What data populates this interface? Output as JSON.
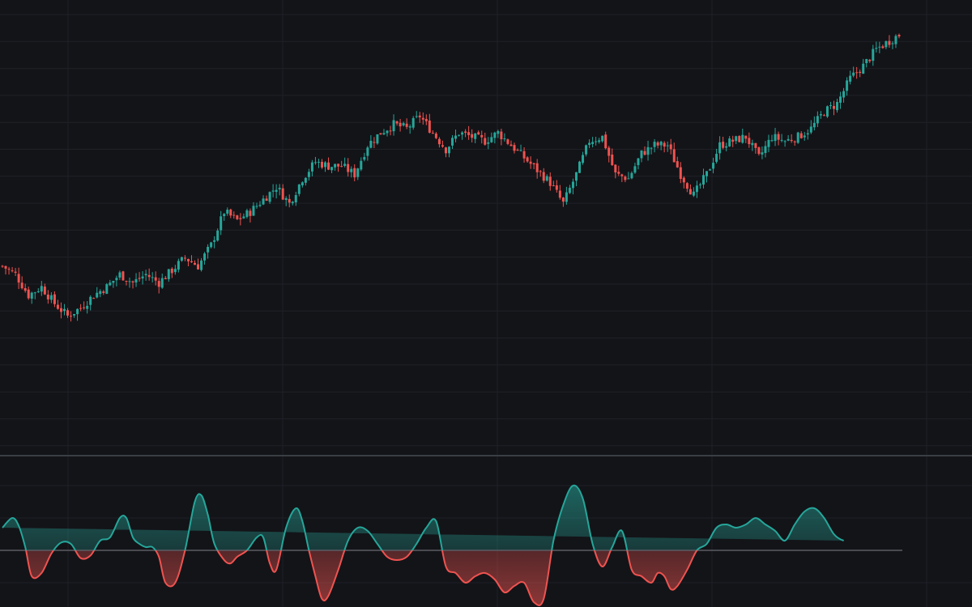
{
  "theme": {
    "background": "#131418",
    "grid": "#1f2127",
    "separator": "#3a3d44",
    "zero_line": "#5a5d63",
    "up_color": "#26a69a",
    "down_color": "#ef5350"
  },
  "chart_data": [
    {
      "type": "candlestick",
      "title": "",
      "xlabel": "",
      "ylabel": "",
      "grid": true,
      "ylim": [
        0,
        100
      ],
      "close_path": [
        [
          0,
          42
        ],
        [
          4,
          40
        ],
        [
          8,
          35
        ],
        [
          12,
          37
        ],
        [
          16,
          33
        ],
        [
          20,
          30
        ],
        [
          24,
          32
        ],
        [
          28,
          35
        ],
        [
          32,
          37
        ],
        [
          36,
          40
        ],
        [
          40,
          38
        ],
        [
          44,
          40
        ],
        [
          48,
          38
        ],
        [
          52,
          41
        ],
        [
          56,
          44
        ],
        [
          60,
          42
        ],
        [
          64,
          47
        ],
        [
          68,
          55
        ],
        [
          72,
          53
        ],
        [
          76,
          55
        ],
        [
          80,
          58
        ],
        [
          84,
          61
        ],
        [
          88,
          57
        ],
        [
          92,
          63
        ],
        [
          96,
          67
        ],
        [
          100,
          66
        ],
        [
          104,
          66
        ],
        [
          108,
          64
        ],
        [
          112,
          71
        ],
        [
          116,
          74
        ],
        [
          120,
          76
        ],
        [
          124,
          75
        ],
        [
          128,
          78
        ],
        [
          132,
          74
        ],
        [
          136,
          70
        ],
        [
          140,
          74
        ],
        [
          144,
          73
        ],
        [
          148,
          72
        ],
        [
          152,
          74
        ],
        [
          156,
          71
        ],
        [
          160,
          68
        ],
        [
          164,
          65
        ],
        [
          168,
          62
        ],
        [
          172,
          57
        ],
        [
          176,
          64
        ],
        [
          180,
          72
        ],
        [
          184,
          73
        ],
        [
          188,
          64
        ],
        [
          192,
          63
        ],
        [
          196,
          69
        ],
        [
          200,
          71
        ],
        [
          204,
          71
        ],
        [
          208,
          64
        ],
        [
          212,
          59
        ],
        [
          216,
          64
        ],
        [
          220,
          71
        ],
        [
          224,
          72
        ],
        [
          228,
          73
        ],
        [
          232,
          68
        ],
        [
          236,
          73
        ],
        [
          240,
          72
        ],
        [
          244,
          73
        ],
        [
          248,
          75
        ],
        [
          252,
          79
        ],
        [
          256,
          81
        ],
        [
          260,
          87
        ],
        [
          264,
          90
        ],
        [
          268,
          94
        ],
        [
          272,
          96
        ],
        [
          276,
          98
        ]
      ],
      "count": 276
    },
    {
      "type": "area",
      "title": "",
      "xlabel": "",
      "ylabel": "",
      "baseline": 0,
      "ylim": [
        -1,
        1.05
      ],
      "x": [
        0,
        3,
        5,
        7,
        9,
        12,
        15,
        18,
        21,
        24,
        27,
        30,
        33,
        36,
        38,
        40,
        42,
        44,
        46,
        48,
        50,
        53,
        56,
        59,
        61,
        63,
        65,
        68,
        70,
        72,
        75,
        78,
        80,
        82,
        84,
        87,
        90,
        92,
        94,
        96,
        98,
        100,
        103,
        106,
        109,
        112,
        115,
        118,
        121,
        124,
        127,
        130,
        133,
        136,
        139,
        142,
        145,
        148,
        151,
        154,
        157,
        160,
        163,
        166,
        169,
        172,
        175,
        178,
        181,
        184,
        187,
        190,
        193,
        196,
        199,
        201,
        203,
        205,
        207,
        210,
        213,
        216,
        219,
        222,
        225,
        228,
        231,
        234,
        237,
        240,
        243,
        246,
        249,
        252,
        255,
        258,
        261,
        264,
        267,
        270,
        273,
        276
      ],
      "values": [
        0.35,
        0.5,
        0.38,
        0.05,
        -0.4,
        -0.35,
        -0.05,
        0.12,
        0.1,
        -0.12,
        -0.08,
        0.15,
        0.2,
        0.5,
        0.5,
        0.2,
        0.1,
        0.05,
        0.05,
        -0.1,
        -0.5,
        -0.5,
        0.0,
        0.75,
        0.85,
        0.55,
        0.1,
        -0.15,
        -0.2,
        -0.1,
        0.0,
        0.2,
        0.2,
        -0.2,
        -0.3,
        0.35,
        0.65,
        0.45,
        0.0,
        -0.4,
        -0.75,
        -0.7,
        -0.3,
        0.15,
        0.35,
        0.3,
        0.1,
        -0.1,
        -0.15,
        -0.1,
        0.1,
        0.35,
        0.45,
        -0.25,
        -0.35,
        -0.5,
        -0.4,
        -0.35,
        -0.45,
        -0.65,
        -0.55,
        -0.5,
        -0.8,
        -0.75,
        0.15,
        0.7,
        1.0,
        0.8,
        0.1,
        -0.25,
        0.05,
        0.3,
        -0.3,
        -0.4,
        -0.5,
        -0.35,
        -0.4,
        -0.6,
        -0.55,
        -0.3,
        0.0,
        0.1,
        0.35,
        0.4,
        0.35,
        0.4,
        0.5,
        0.4,
        0.3,
        0.15,
        0.4,
        0.6,
        0.65,
        0.5,
        0.25,
        0.15,
        0.15
      ],
      "last_value": 0.22
    }
  ]
}
